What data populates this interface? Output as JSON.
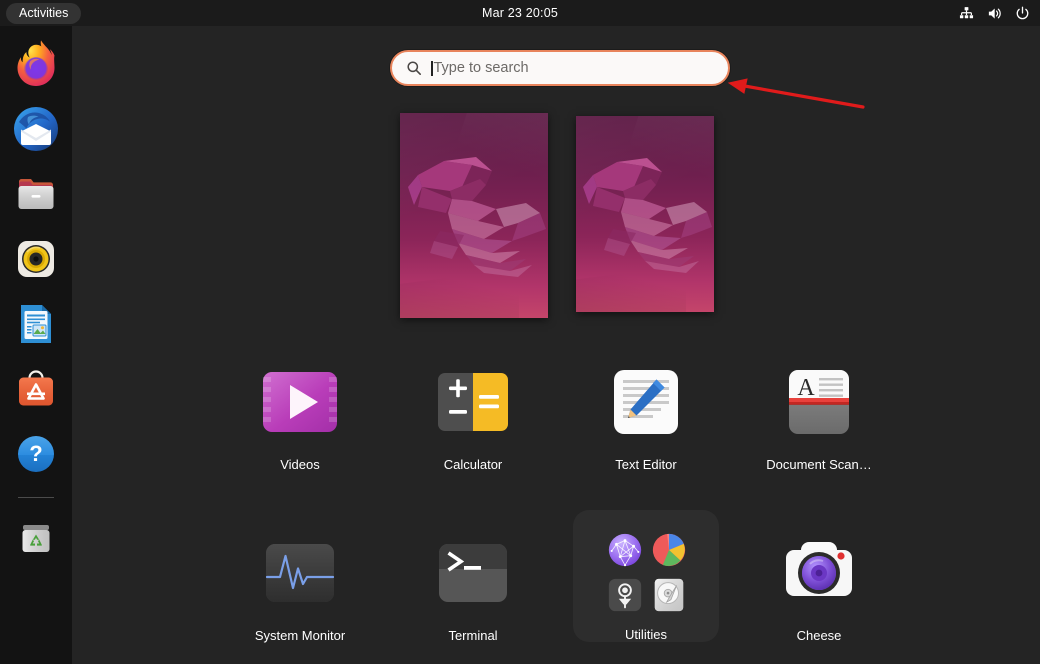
{
  "topbar": {
    "activities_label": "Activities",
    "clock": "Mar 23  20:05",
    "tray": [
      {
        "name": "network-icon",
        "label": "Network"
      },
      {
        "name": "volume-icon",
        "label": "Volume"
      },
      {
        "name": "power-icon",
        "label": "Power"
      }
    ]
  },
  "dock": {
    "items": [
      {
        "name": "dock-item-firefox",
        "label": "Firefox"
      },
      {
        "name": "dock-item-thunderbird",
        "label": "Thunderbird Mail"
      },
      {
        "name": "dock-item-files",
        "label": "Files"
      },
      {
        "name": "dock-item-rhythmbox",
        "label": "Rhythmbox"
      },
      {
        "name": "dock-item-libreoffice-impress",
        "label": "LibreOffice Impress"
      },
      {
        "name": "dock-item-ubuntu-software",
        "label": "Ubuntu Software"
      },
      {
        "name": "dock-item-help",
        "label": "Help"
      },
      {
        "name": "dock-item-trash",
        "label": "Trash"
      }
    ]
  },
  "search": {
    "placeholder": "Type to search",
    "value": "",
    "icon": "search-icon",
    "focus_color": "#e8845c",
    "field_color": "#fbf9f8"
  },
  "workspaces": [
    {
      "name": "workspace-thumbnail-1",
      "label": "Workspace 1",
      "active": true
    },
    {
      "name": "workspace-thumbnail-2",
      "label": "Workspace 2",
      "active": false
    }
  ],
  "apps": {
    "row1": [
      {
        "name": "app-videos",
        "label": "Videos",
        "icon": "videos-icon"
      },
      {
        "name": "app-calculator",
        "label": "Calculator",
        "icon": "calculator-icon"
      },
      {
        "name": "app-text-editor",
        "label": "Text Editor",
        "icon": "text-editor-icon"
      },
      {
        "name": "app-document-scanner",
        "label": "Document Scan…",
        "icon": "document-scanner-icon"
      }
    ],
    "row2": [
      {
        "name": "app-system-monitor",
        "label": "System Monitor",
        "icon": "system-monitor-icon"
      },
      {
        "name": "app-terminal",
        "label": "Terminal",
        "icon": "terminal-icon"
      },
      {
        "name": "app-utilities-folder",
        "label": "Utilities",
        "icon": "folder-icon"
      },
      {
        "name": "app-cheese",
        "label": "Cheese",
        "icon": "cheese-icon"
      }
    ]
  },
  "utilities_folder": {
    "label": "Utilities",
    "contents": [
      {
        "name": "mini-connections-icon",
        "label": "Connections"
      },
      {
        "name": "mini-disk-usage-analyzer-icon",
        "label": "Disk Usage Analyzer"
      },
      {
        "name": "mini-logs-icon",
        "label": "Logs"
      },
      {
        "name": "mini-disks-icon",
        "label": "Disks"
      }
    ]
  },
  "annotation": {
    "name": "red-arrow-annotation",
    "color": "#e01b1b",
    "points_to": "search-input"
  },
  "colors": {
    "background": "#242424",
    "topbar": "#1b1b1b",
    "dock": "#131313",
    "folder_background": "#2d2d2d",
    "accent": "#e95420",
    "text": "#ffffff"
  }
}
